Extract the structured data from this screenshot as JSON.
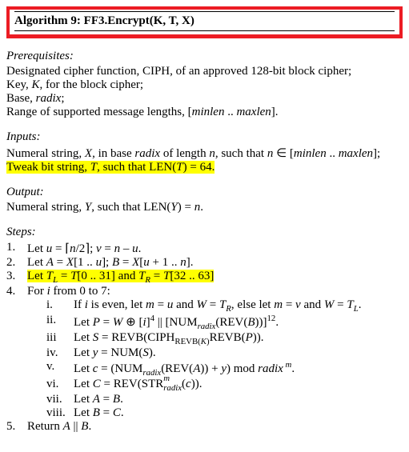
{
  "title": "Algorithm 9: FF3.Encrypt(K, T, X)",
  "prereq_head": "Prerequisites:",
  "prereq1": "Designated cipher function, CIPH, of an approved 128-bit block cipher;",
  "prereq2_a": "Key, ",
  "prereq2_b": "K",
  "prereq2_c": ", for the block cipher;",
  "prereq3_a": "Base, ",
  "prereq3_b": "radix",
  "prereq3_c": ";",
  "prereq4_a": "Range of supported message lengths, [",
  "prereq4_b": "minlen",
  "prereq4_c": " .. ",
  "prereq4_d": "maxlen",
  "prereq4_e": "].",
  "inputs_head": "Inputs:",
  "in1_a": "Numeral string, ",
  "in1_b": "X",
  "in1_c": ", in base ",
  "in1_d": "radix",
  "in1_e": " of length ",
  "in1_f": "n",
  "in1_g": ", such that ",
  "in1_h": "n",
  "in1_i": " ∈ [",
  "in1_j": "minlen",
  "in1_k": " .. ",
  "in1_l": "maxlen",
  "in1_m": "];",
  "in2_a": "Tweak bit string, ",
  "in2_b": "T",
  "in2_c": ", such that ",
  "in2_d": "LEN",
  "in2_e": "(",
  "in2_f": "T",
  "in2_g": ") = 64.",
  "output_head": "Output:",
  "out_a": "Numeral string, ",
  "out_b": "Y",
  "out_c": ", such that LEN(",
  "out_d": "Y",
  "out_e": ") = ",
  "out_f": "n",
  "out_g": ".",
  "steps_head": "Steps:",
  "n1": "1.",
  "s1_a": "Let ",
  "s1_b": "u",
  "s1_c": " = ⌈",
  "s1_d": "n",
  "s1_e": "/2⌉; ",
  "s1_f": "v",
  "s1_g": " = ",
  "s1_h": "n",
  "s1_i": " – ",
  "s1_j": "u",
  "s1_k": ".",
  "n2": "2.",
  "s2_a": "Let ",
  "s2_b": "A",
  "s2_c": " = ",
  "s2_d": "X",
  "s2_e": "[1 .. ",
  "s2_f": "u",
  "s2_g": "]; ",
  "s2_h": "B",
  "s2_i": " = ",
  "s2_j": "X",
  "s2_k": "[",
  "s2_l": "u",
  "s2_m": " + 1 .. ",
  "s2_n": "n",
  "s2_o": "].",
  "n3": "3.",
  "s3_a": "Let ",
  "s3_b": "T",
  "s3_c": "L",
  "s3_d": " = ",
  "s3_e": "T",
  "s3_f": "[0 .. 31] and ",
  "s3_g": "T",
  "s3_h": "R",
  "s3_i": " = ",
  "s3_j": "T",
  "s3_k": "[32 .. 63]",
  "n4": "4.",
  "s4_a": "For ",
  "s4_b": "i",
  "s4_c": " from 0 to 7:",
  "sub1_n": "i.",
  "sub1_a": "If ",
  "sub1_b": "i",
  "sub1_c": " is even, let ",
  "sub1_d": "m",
  "sub1_e": " = ",
  "sub1_f": "u",
  "sub1_g": " and ",
  "sub1_h": "W",
  "sub1_i": " = ",
  "sub1_j": "T",
  "sub1_k": "R",
  "sub1_l": ", else let ",
  "sub1_m2": "m",
  "sub1_n2": " = ",
  "sub1_o": "v",
  "sub1_p": " and ",
  "sub1_q": "W",
  "sub1_r": " = ",
  "sub1_s": "T",
  "sub1_t": "L",
  "sub1_u": ".",
  "sub2_n": "ii.",
  "sub2_a": "Let ",
  "sub2_b": "P",
  "sub2_c": " = ",
  "sub2_d": "W",
  "sub2_e": " ⊕ [",
  "sub2_f": "i",
  "sub2_g": "]",
  "sub2_h": "4",
  "sub2_i": " || [NUM",
  "sub2_j": "radix",
  "sub2_k": "(REV(",
  "sub2_l": "B",
  "sub2_m": "))]",
  "sub2_sup": "12",
  "sub2_o": ".",
  "sub3_n": "iii",
  "sub3_a": "Let ",
  "sub3_b": "S",
  "sub3_c": " = REVB(CIPH",
  "sub3_d": "REVB(",
  "sub3_e": "K",
  "sub3_f": ")",
  "sub3_g": "REVB(",
  "sub3_h": "P",
  "sub3_i": ")).",
  "sub4_n": "iv.",
  "sub4_a": "Let ",
  "sub4_b": "y",
  "sub4_c": " = NUM(",
  "sub4_d": "S",
  "sub4_e": ").",
  "sub5_n": "v.",
  "sub5_a": "Let ",
  "sub5_b": "c",
  "sub5_c": " = (NUM",
  "sub5_d": "radix",
  "sub5_e": "(REV(",
  "sub5_f": "A",
  "sub5_g": ")) + ",
  "sub5_h": "y",
  "sub5_i": ") mod ",
  "sub5_j": "radix",
  "sub5_k": " m",
  "sub5_l": ".",
  "sub6_n": "vi.",
  "sub6_a": "Let ",
  "sub6_b": "C",
  "sub6_c": " = REV(STR",
  "sub6_d": "m",
  "sub6_e": "radix",
  "sub6_f": "(",
  "sub6_g": "c",
  "sub6_h": ")).",
  "sub7_n": "vii.",
  "sub7_a": "Let ",
  "sub7_b": "A",
  "sub7_c": " = ",
  "sub7_d": "B",
  "sub7_e": ".",
  "sub8_n": "viii.",
  "sub8_a": "Let ",
  "sub8_b": "B",
  "sub8_c": " = ",
  "sub8_d": "C",
  "sub8_e": ".",
  "n5": "5.",
  "s5_a": "Return ",
  "s5_b": "A",
  "s5_c": " || ",
  "s5_d": "B",
  "s5_e": "."
}
